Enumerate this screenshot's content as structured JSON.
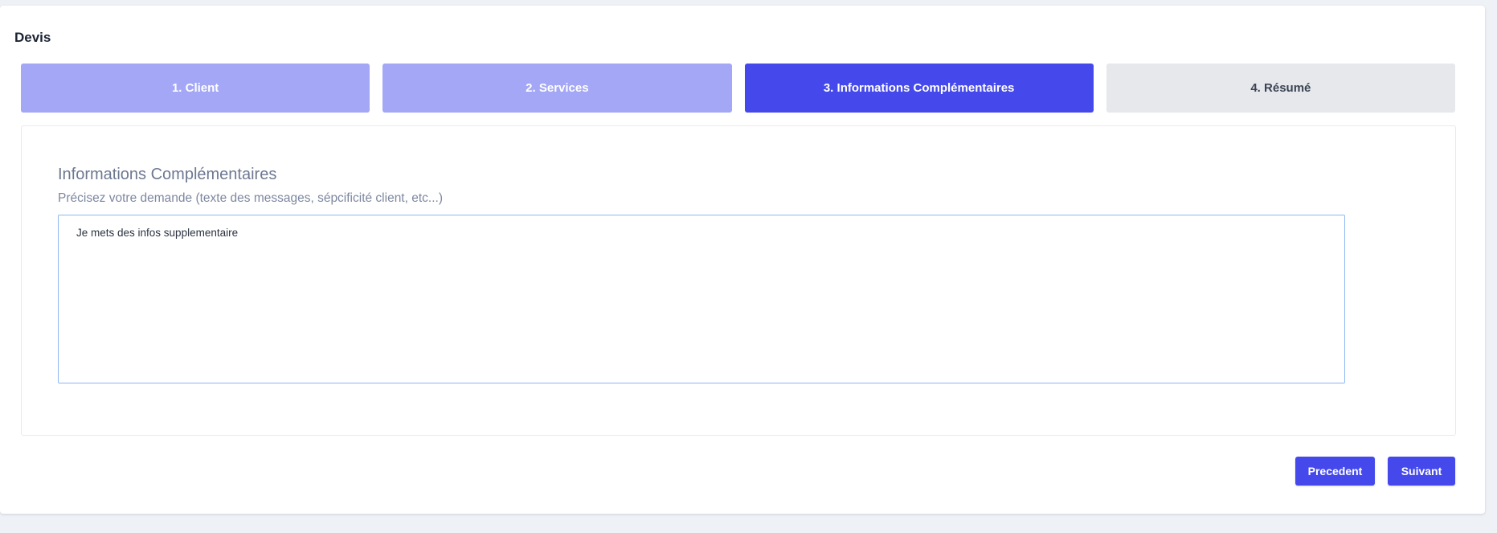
{
  "card": {
    "title": "Devis"
  },
  "steps": [
    {
      "label": "1. Client",
      "state": "done"
    },
    {
      "label": "2. Services",
      "state": "done"
    },
    {
      "label": "3. Informations Complémentaires",
      "state": "active"
    },
    {
      "label": "4. Résumé",
      "state": "todo"
    }
  ],
  "section": {
    "title": "Informations Complémentaires",
    "subtitle": "Précisez votre demande (texte des messages, sépcificité client, etc...)",
    "textarea_value": "Je mets des infos supplementaire"
  },
  "actions": {
    "previous_label": "Precedent",
    "next_label": "Suivant"
  },
  "colors": {
    "accent": "#4549ec",
    "step_done": "#a3a7f5",
    "step_todo": "#e6e8ec",
    "background": "#eef1f5"
  }
}
